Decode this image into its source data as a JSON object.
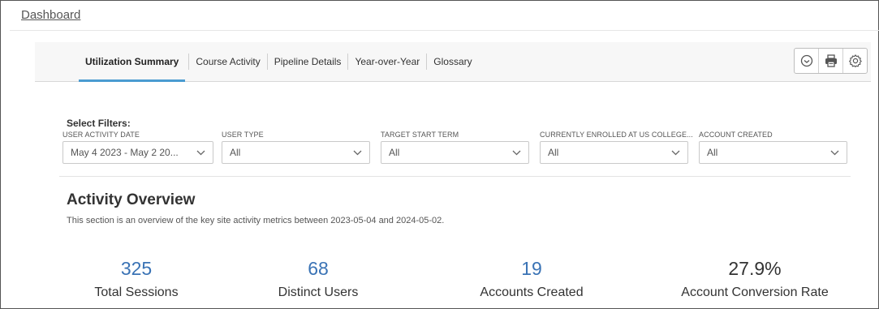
{
  "breadcrumb": "Dashboard",
  "tabs": [
    {
      "label": "Utilization Summary",
      "active": true
    },
    {
      "label": "Course Activity"
    },
    {
      "label": "Pipeline Details"
    },
    {
      "label": "Year-over-Year"
    },
    {
      "label": "Glossary"
    }
  ],
  "toolbar": {
    "icons": [
      "clock-icon",
      "printer-icon",
      "gear-icon"
    ]
  },
  "filters": {
    "title": "Select Filters:",
    "items": [
      {
        "label": "USER ACTIVITY DATE",
        "value": "May 4 2023 - May 2 20..."
      },
      {
        "label": "USER TYPE",
        "value": "All"
      },
      {
        "label": "TARGET START TERM",
        "value": "All"
      },
      {
        "label": "CURRENTLY ENROLLED AT US COLLEGE...",
        "value": "All"
      },
      {
        "label": "ACCOUNT CREATED",
        "value": "All"
      }
    ]
  },
  "overview": {
    "title": "Activity Overview",
    "description": "This section is an overview of the key site activity metrics between 2023-05-04 and 2024-05-02."
  },
  "metrics": [
    {
      "value": "325",
      "label": "Total Sessions"
    },
    {
      "value": "68",
      "label": "Distinct Users"
    },
    {
      "value": "19",
      "label": "Accounts Created"
    },
    {
      "value": "27.9%",
      "label": "Account Conversion Rate"
    }
  ],
  "colors": {
    "accent": "#4a9bd1",
    "metric_value": "#3a73b5"
  }
}
